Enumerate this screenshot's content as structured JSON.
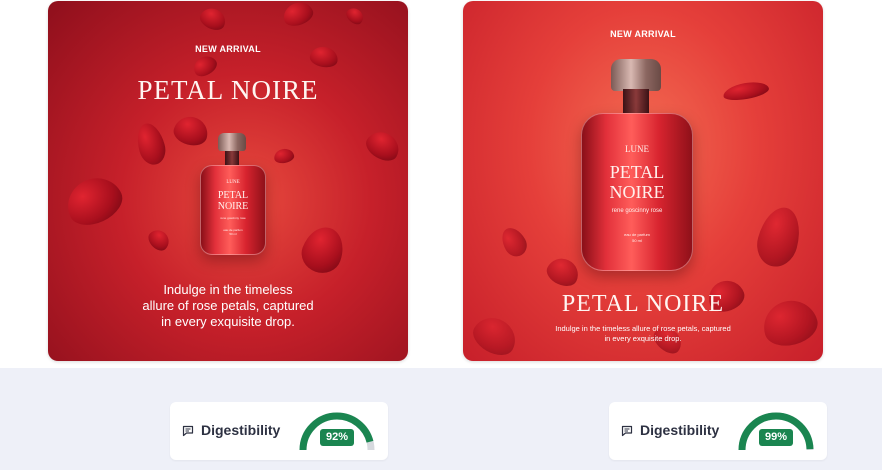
{
  "cards": [
    {
      "tag": "NEW ARRIVAL",
      "title": "PETAL NOIRE",
      "body_lines": [
        "Indulge in the timeless",
        "allure of rose petals, captured",
        "in every exquisite drop."
      ],
      "bottle": {
        "brand": "LUNE",
        "name_line1": "PETAL",
        "name_line2": "NOIRE",
        "sub": "rene goscinny rose",
        "fine1": "eau de parfum",
        "fine2": "50 ml"
      }
    },
    {
      "tag": "NEW ARRIVAL",
      "title": "PETAL NOIRE",
      "body_lines": [
        "Indulge in the timeless allure of rose petals, captured",
        "in every exquisite drop."
      ],
      "bottle": {
        "brand": "LUNE",
        "name_line1": "PETAL",
        "name_line2": "NOIRE",
        "sub": "rene goscinny rose",
        "fine1": "eau de parfum",
        "fine2": "50 ml"
      }
    }
  ],
  "metrics": [
    {
      "label": "Digestibility",
      "value_text": "92%",
      "value": 92,
      "icon": "message-square-icon"
    },
    {
      "label": "Digestibility",
      "value_text": "99%",
      "value": 99,
      "icon": "message-square-icon"
    }
  ],
  "colors": {
    "gauge_fill": "#1a8550",
    "gauge_track": "#d6d9de",
    "page_band": "#eef0f8"
  }
}
